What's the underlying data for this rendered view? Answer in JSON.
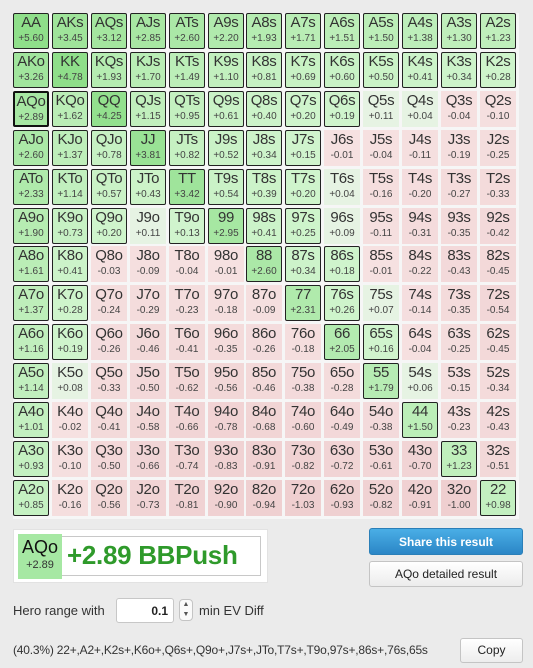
{
  "grid": {
    "ranks": [
      "A",
      "K",
      "Q",
      "J",
      "T",
      "9",
      "8",
      "7",
      "6",
      "5",
      "4",
      "3",
      "2"
    ],
    "selected": "AQo",
    "rows": [
      [
        {
          "hand": "AA",
          "ev": "+5.60",
          "push": true
        },
        {
          "hand": "AKs",
          "ev": "+3.45",
          "push": true
        },
        {
          "hand": "AQs",
          "ev": "+3.12",
          "push": true
        },
        {
          "hand": "AJs",
          "ev": "+2.85",
          "push": true
        },
        {
          "hand": "ATs",
          "ev": "+2.60",
          "push": true
        },
        {
          "hand": "A9s",
          "ev": "+2.20",
          "push": true
        },
        {
          "hand": "A8s",
          "ev": "+1.93",
          "push": true
        },
        {
          "hand": "A7s",
          "ev": "+1.71",
          "push": true
        },
        {
          "hand": "A6s",
          "ev": "+1.51",
          "push": true
        },
        {
          "hand": "A5s",
          "ev": "+1.50",
          "push": true
        },
        {
          "hand": "A4s",
          "ev": "+1.38",
          "push": true
        },
        {
          "hand": "A3s",
          "ev": "+1.30",
          "push": true
        },
        {
          "hand": "A2s",
          "ev": "+1.23",
          "push": true
        }
      ],
      [
        {
          "hand": "AKo",
          "ev": "+3.26",
          "push": true
        },
        {
          "hand": "KK",
          "ev": "+4.78",
          "push": true
        },
        {
          "hand": "KQs",
          "ev": "+1.93",
          "push": true
        },
        {
          "hand": "KJs",
          "ev": "+1.70",
          "push": true
        },
        {
          "hand": "KTs",
          "ev": "+1.49",
          "push": true
        },
        {
          "hand": "K9s",
          "ev": "+1.10",
          "push": true
        },
        {
          "hand": "K8s",
          "ev": "+0.81",
          "push": true
        },
        {
          "hand": "K7s",
          "ev": "+0.69",
          "push": true
        },
        {
          "hand": "K6s",
          "ev": "+0.60",
          "push": true
        },
        {
          "hand": "K5s",
          "ev": "+0.50",
          "push": true
        },
        {
          "hand": "K4s",
          "ev": "+0.41",
          "push": true
        },
        {
          "hand": "K3s",
          "ev": "+0.34",
          "push": true
        },
        {
          "hand": "K2s",
          "ev": "+0.28",
          "push": true
        }
      ],
      [
        {
          "hand": "AQo",
          "ev": "+2.89",
          "push": true
        },
        {
          "hand": "KQo",
          "ev": "+1.62",
          "push": true
        },
        {
          "hand": "QQ",
          "ev": "+4.25",
          "push": true
        },
        {
          "hand": "QJs",
          "ev": "+1.15",
          "push": true
        },
        {
          "hand": "QTs",
          "ev": "+0.95",
          "push": true
        },
        {
          "hand": "Q9s",
          "ev": "+0.61",
          "push": true
        },
        {
          "hand": "Q8s",
          "ev": "+0.40",
          "push": true
        },
        {
          "hand": "Q7s",
          "ev": "+0.20",
          "push": true
        },
        {
          "hand": "Q6s",
          "ev": "+0.19",
          "push": true
        },
        {
          "hand": "Q5s",
          "ev": "+0.11",
          "push": false
        },
        {
          "hand": "Q4s",
          "ev": "+0.04",
          "push": false
        },
        {
          "hand": "Q3s",
          "ev": "-0.04",
          "push": false
        },
        {
          "hand": "Q2s",
          "ev": "-0.10",
          "push": false
        }
      ],
      [
        {
          "hand": "AJo",
          "ev": "+2.60",
          "push": true
        },
        {
          "hand": "KJo",
          "ev": "+1.37",
          "push": true
        },
        {
          "hand": "QJo",
          "ev": "+0.78",
          "push": true
        },
        {
          "hand": "JJ",
          "ev": "+3.81",
          "push": true
        },
        {
          "hand": "JTs",
          "ev": "+0.82",
          "push": true
        },
        {
          "hand": "J9s",
          "ev": "+0.52",
          "push": true
        },
        {
          "hand": "J8s",
          "ev": "+0.34",
          "push": true
        },
        {
          "hand": "J7s",
          "ev": "+0.15",
          "push": true
        },
        {
          "hand": "J6s",
          "ev": "-0.01",
          "push": false
        },
        {
          "hand": "J5s",
          "ev": "-0.04",
          "push": false
        },
        {
          "hand": "J4s",
          "ev": "-0.11",
          "push": false
        },
        {
          "hand": "J3s",
          "ev": "-0.19",
          "push": false
        },
        {
          "hand": "J2s",
          "ev": "-0.25",
          "push": false
        }
      ],
      [
        {
          "hand": "ATo",
          "ev": "+2.33",
          "push": true
        },
        {
          "hand": "KTo",
          "ev": "+1.14",
          "push": true
        },
        {
          "hand": "QTo",
          "ev": "+0.57",
          "push": true
        },
        {
          "hand": "JTo",
          "ev": "+0.43",
          "push": true
        },
        {
          "hand": "TT",
          "ev": "+3.42",
          "push": true
        },
        {
          "hand": "T9s",
          "ev": "+0.54",
          "push": true
        },
        {
          "hand": "T8s",
          "ev": "+0.39",
          "push": true
        },
        {
          "hand": "T7s",
          "ev": "+0.20",
          "push": true
        },
        {
          "hand": "T6s",
          "ev": "+0.04",
          "push": false
        },
        {
          "hand": "T5s",
          "ev": "-0.16",
          "push": false
        },
        {
          "hand": "T4s",
          "ev": "-0.20",
          "push": false
        },
        {
          "hand": "T3s",
          "ev": "-0.27",
          "push": false
        },
        {
          "hand": "T2s",
          "ev": "-0.33",
          "push": false
        }
      ],
      [
        {
          "hand": "A9o",
          "ev": "+1.90",
          "push": true
        },
        {
          "hand": "K9o",
          "ev": "+0.73",
          "push": true
        },
        {
          "hand": "Q9o",
          "ev": "+0.20",
          "push": true
        },
        {
          "hand": "J9o",
          "ev": "+0.11",
          "push": false
        },
        {
          "hand": "T9o",
          "ev": "+0.13",
          "push": true
        },
        {
          "hand": "99",
          "ev": "+2.95",
          "push": true
        },
        {
          "hand": "98s",
          "ev": "+0.41",
          "push": true
        },
        {
          "hand": "97s",
          "ev": "+0.25",
          "push": true
        },
        {
          "hand": "96s",
          "ev": "+0.09",
          "push": false
        },
        {
          "hand": "95s",
          "ev": "-0.11",
          "push": false
        },
        {
          "hand": "94s",
          "ev": "-0.31",
          "push": false
        },
        {
          "hand": "93s",
          "ev": "-0.35",
          "push": false
        },
        {
          "hand": "92s",
          "ev": "-0.42",
          "push": false
        }
      ],
      [
        {
          "hand": "A8o",
          "ev": "+1.61",
          "push": true
        },
        {
          "hand": "K8o",
          "ev": "+0.41",
          "push": true
        },
        {
          "hand": "Q8o",
          "ev": "-0.03",
          "push": false
        },
        {
          "hand": "J8o",
          "ev": "-0.09",
          "push": false
        },
        {
          "hand": "T8o",
          "ev": "-0.04",
          "push": false
        },
        {
          "hand": "98o",
          "ev": "-0.01",
          "push": false
        },
        {
          "hand": "88",
          "ev": "+2.60",
          "push": true
        },
        {
          "hand": "87s",
          "ev": "+0.34",
          "push": true
        },
        {
          "hand": "86s",
          "ev": "+0.18",
          "push": true
        },
        {
          "hand": "85s",
          "ev": "-0.01",
          "push": false
        },
        {
          "hand": "84s",
          "ev": "-0.22",
          "push": false
        },
        {
          "hand": "83s",
          "ev": "-0.43",
          "push": false
        },
        {
          "hand": "82s",
          "ev": "-0.45",
          "push": false
        }
      ],
      [
        {
          "hand": "A7o",
          "ev": "+1.37",
          "push": true
        },
        {
          "hand": "K7o",
          "ev": "+0.28",
          "push": true
        },
        {
          "hand": "Q7o",
          "ev": "-0.24",
          "push": false
        },
        {
          "hand": "J7o",
          "ev": "-0.29",
          "push": false
        },
        {
          "hand": "T7o",
          "ev": "-0.23",
          "push": false
        },
        {
          "hand": "97o",
          "ev": "-0.18",
          "push": false
        },
        {
          "hand": "87o",
          "ev": "-0.09",
          "push": false
        },
        {
          "hand": "77",
          "ev": "+2.31",
          "push": true
        },
        {
          "hand": "76s",
          "ev": "+0.26",
          "push": true
        },
        {
          "hand": "75s",
          "ev": "+0.07",
          "push": false
        },
        {
          "hand": "74s",
          "ev": "-0.14",
          "push": false
        },
        {
          "hand": "73s",
          "ev": "-0.35",
          "push": false
        },
        {
          "hand": "72s",
          "ev": "-0.54",
          "push": false
        }
      ],
      [
        {
          "hand": "A6o",
          "ev": "+1.16",
          "push": true
        },
        {
          "hand": "K6o",
          "ev": "+0.19",
          "push": true
        },
        {
          "hand": "Q6o",
          "ev": "-0.26",
          "push": false
        },
        {
          "hand": "J6o",
          "ev": "-0.46",
          "push": false
        },
        {
          "hand": "T6o",
          "ev": "-0.41",
          "push": false
        },
        {
          "hand": "96o",
          "ev": "-0.35",
          "push": false
        },
        {
          "hand": "86o",
          "ev": "-0.26",
          "push": false
        },
        {
          "hand": "76o",
          "ev": "-0.18",
          "push": false
        },
        {
          "hand": "66",
          "ev": "+2.05",
          "push": true
        },
        {
          "hand": "65s",
          "ev": "+0.16",
          "push": true
        },
        {
          "hand": "64s",
          "ev": "-0.04",
          "push": false
        },
        {
          "hand": "63s",
          "ev": "-0.25",
          "push": false
        },
        {
          "hand": "62s",
          "ev": "-0.45",
          "push": false
        }
      ],
      [
        {
          "hand": "A5o",
          "ev": "+1.14",
          "push": true
        },
        {
          "hand": "K5o",
          "ev": "+0.08",
          "push": false
        },
        {
          "hand": "Q5o",
          "ev": "-0.33",
          "push": false
        },
        {
          "hand": "J5o",
          "ev": "-0.50",
          "push": false
        },
        {
          "hand": "T5o",
          "ev": "-0.62",
          "push": false
        },
        {
          "hand": "95o",
          "ev": "-0.56",
          "push": false
        },
        {
          "hand": "85o",
          "ev": "-0.46",
          "push": false
        },
        {
          "hand": "75o",
          "ev": "-0.38",
          "push": false
        },
        {
          "hand": "65o",
          "ev": "-0.28",
          "push": false
        },
        {
          "hand": "55",
          "ev": "+1.79",
          "push": true
        },
        {
          "hand": "54s",
          "ev": "+0.06",
          "push": false
        },
        {
          "hand": "53s",
          "ev": "-0.15",
          "push": false
        },
        {
          "hand": "52s",
          "ev": "-0.34",
          "push": false
        }
      ],
      [
        {
          "hand": "A4o",
          "ev": "+1.01",
          "push": true
        },
        {
          "hand": "K4o",
          "ev": "-0.02",
          "push": false
        },
        {
          "hand": "Q4o",
          "ev": "-0.41",
          "push": false
        },
        {
          "hand": "J4o",
          "ev": "-0.58",
          "push": false
        },
        {
          "hand": "T4o",
          "ev": "-0.66",
          "push": false
        },
        {
          "hand": "94o",
          "ev": "-0.78",
          "push": false
        },
        {
          "hand": "84o",
          "ev": "-0.68",
          "push": false
        },
        {
          "hand": "74o",
          "ev": "-0.60",
          "push": false
        },
        {
          "hand": "64o",
          "ev": "-0.49",
          "push": false
        },
        {
          "hand": "54o",
          "ev": "-0.38",
          "push": false
        },
        {
          "hand": "44",
          "ev": "+1.50",
          "push": true
        },
        {
          "hand": "43s",
          "ev": "-0.23",
          "push": false
        },
        {
          "hand": "42s",
          "ev": "-0.43",
          "push": false
        }
      ],
      [
        {
          "hand": "A3o",
          "ev": "+0.93",
          "push": true
        },
        {
          "hand": "K3o",
          "ev": "-0.10",
          "push": false
        },
        {
          "hand": "Q3o",
          "ev": "-0.50",
          "push": false
        },
        {
          "hand": "J3o",
          "ev": "-0.66",
          "push": false
        },
        {
          "hand": "T3o",
          "ev": "-0.74",
          "push": false
        },
        {
          "hand": "93o",
          "ev": "-0.83",
          "push": false
        },
        {
          "hand": "83o",
          "ev": "-0.91",
          "push": false
        },
        {
          "hand": "73o",
          "ev": "-0.82",
          "push": false
        },
        {
          "hand": "63o",
          "ev": "-0.72",
          "push": false
        },
        {
          "hand": "53o",
          "ev": "-0.61",
          "push": false
        },
        {
          "hand": "43o",
          "ev": "-0.70",
          "push": false
        },
        {
          "hand": "33",
          "ev": "+1.23",
          "push": true
        },
        {
          "hand": "32s",
          "ev": "-0.51",
          "push": false
        }
      ],
      [
        {
          "hand": "A2o",
          "ev": "+0.85",
          "push": true
        },
        {
          "hand": "K2o",
          "ev": "-0.16",
          "push": false
        },
        {
          "hand": "Q2o",
          "ev": "-0.56",
          "push": false
        },
        {
          "hand": "J2o",
          "ev": "-0.73",
          "push": false
        },
        {
          "hand": "T2o",
          "ev": "-0.81",
          "push": false
        },
        {
          "hand": "92o",
          "ev": "-0.90",
          "push": false
        },
        {
          "hand": "82o",
          "ev": "-0.94",
          "push": false
        },
        {
          "hand": "72o",
          "ev": "-1.03",
          "push": false
        },
        {
          "hand": "62o",
          "ev": "-0.93",
          "push": false
        },
        {
          "hand": "52o",
          "ev": "-0.82",
          "push": false
        },
        {
          "hand": "42o",
          "ev": "-0.91",
          "push": false
        },
        {
          "hand": "32o",
          "ev": "-1.00",
          "push": false
        },
        {
          "hand": "22",
          "ev": "+0.98",
          "push": true
        }
      ]
    ]
  },
  "colors": {
    "push_light": "#d2f5cf",
    "push_strong": "#8fdf8a",
    "neutral_positive": "#e6f3e3",
    "negative_light": "#f6e1e1",
    "negative_strong": "#efcfd0",
    "result_green": "#2f9a2b",
    "share_blue": "#2b86c6"
  },
  "result": {
    "hand": "AQo",
    "ev": "+2.89",
    "summary": "+2.89 BBPush"
  },
  "buttons": {
    "share": "Share this result",
    "detailed": "AQo detailed result",
    "copy": "Copy"
  },
  "hero_range": {
    "label": "Hero range with",
    "min_ev_value": "0.1",
    "suffix": "min EV Diff",
    "spinner_up": "▲",
    "spinner_down": "▼"
  },
  "range_string": "(40.3%) 22+,A2+,K2s+,K6o+,Q6s+,Q9o+,J7s+,JTo,T7s+,T9o,97s+,86s+,76s,65s"
}
